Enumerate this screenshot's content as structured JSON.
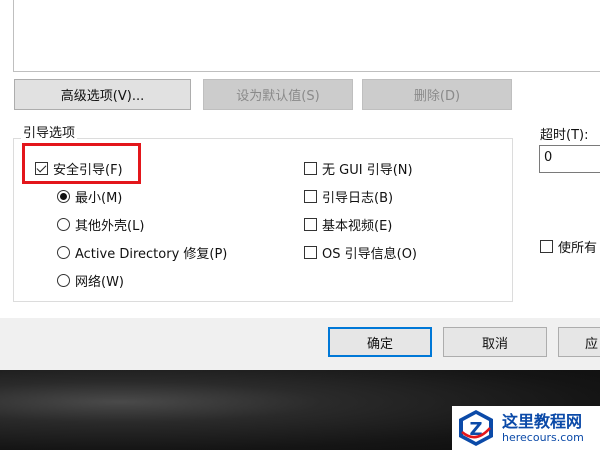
{
  "top_buttons": {
    "advanced": "高级选项(V)...",
    "set_default": "设为默认值(S)",
    "delete": "删除(D)"
  },
  "boot_options": {
    "group_label": "引导选项",
    "safe_boot": "安全引导(F)",
    "minimal": "最小(M)",
    "alternate_shell": "其他外壳(L)",
    "active_directory": "Active Directory 修复(P)",
    "network": "网络(W)",
    "no_gui_boot": "无 GUI 引导(N)",
    "boot_log": "引导日志(B)",
    "base_video": "基本视频(E)",
    "os_boot_info": "OS 引导信息(O)"
  },
  "timeout": {
    "label": "超时(T):",
    "value": "0"
  },
  "make_permanent": "使所有",
  "footer_buttons": {
    "ok": "确定",
    "cancel": "取消",
    "apply": "应"
  },
  "watermark": {
    "title": "这里教程网",
    "url": "herecours.com"
  },
  "colors": {
    "highlight_box": "#e3161b",
    "watermark_blue": "#0b4aa8",
    "default_button_border": "#0078d7"
  }
}
